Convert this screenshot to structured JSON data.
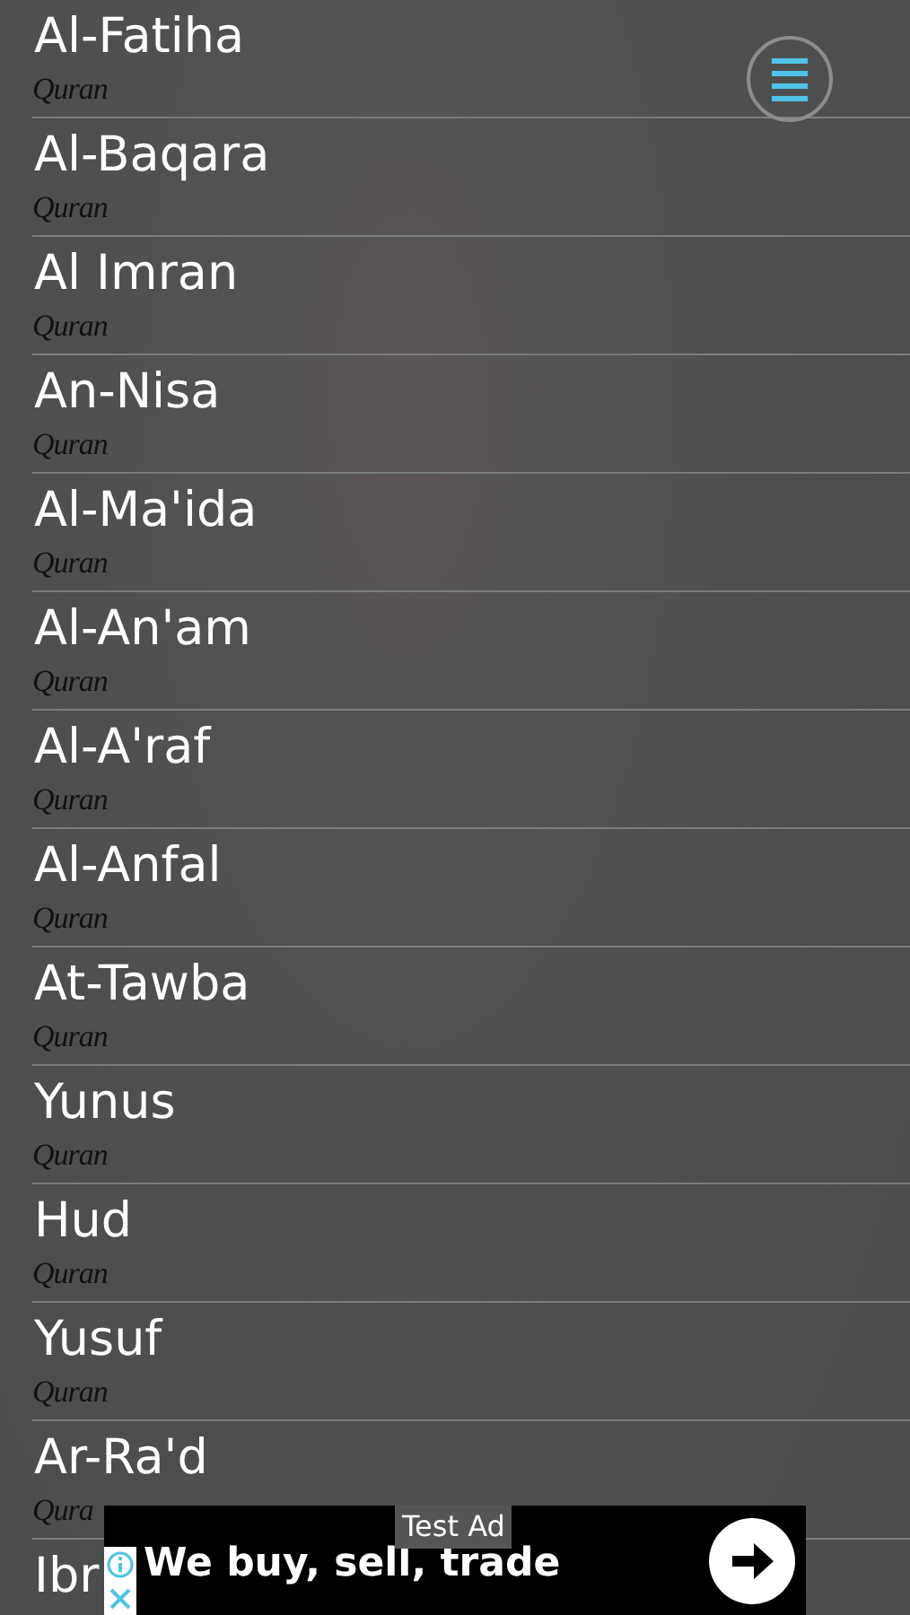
{
  "surahs": [
    {
      "name": "Al-Fatiha",
      "subtitle": "Quran"
    },
    {
      "name": "Al-Baqara",
      "subtitle": "Quran"
    },
    {
      "name": "Al Imran",
      "subtitle": "Quran"
    },
    {
      "name": "An-Nisa",
      "subtitle": "Quran"
    },
    {
      "name": "Al-Ma'ida",
      "subtitle": "Quran"
    },
    {
      "name": "Al-An'am",
      "subtitle": "Quran"
    },
    {
      "name": "Al-A'raf",
      "subtitle": "Quran"
    },
    {
      "name": "Al-Anfal",
      "subtitle": "Quran"
    },
    {
      "name": "At-Tawba",
      "subtitle": "Quran"
    },
    {
      "name": "Yunus",
      "subtitle": "Quran"
    },
    {
      "name": "Hud",
      "subtitle": "Quran"
    },
    {
      "name": "Yusuf",
      "subtitle": "Quran"
    },
    {
      "name": "Ar-Ra'd",
      "subtitle": "Qura"
    },
    {
      "name": "Ibr"
    }
  ],
  "ad": {
    "label": "Test Ad",
    "headline": "We buy, sell, trade"
  }
}
